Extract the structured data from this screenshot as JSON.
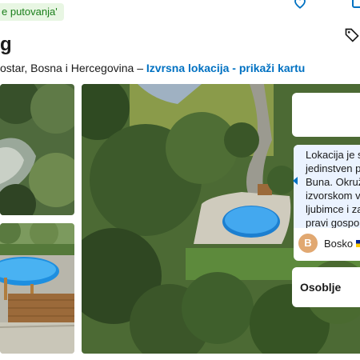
{
  "badge": {
    "text": "e putovanja'"
  },
  "header": {
    "title": "g",
    "address": "ostar, Bosna i Hercegovina –",
    "map_link": "Izvrsna lokacija - prikaži kartu"
  },
  "review": {
    "lines": [
      "Lokacija je s",
      "jedinstven p",
      "Buna. Okruž",
      "izvorskom v",
      "ljubimce i za",
      "pravi gospo"
    ],
    "reviewer_initial": "B",
    "reviewer_name": "Bosko"
  },
  "staff": {
    "label": "Osoblje"
  },
  "icons": {
    "heart": "heart-icon",
    "share": "share-icon",
    "price_tag": "price-tag-icon",
    "flag": "flag-icon"
  },
  "colors": {
    "link": "#0071c2",
    "badge_bg": "#e8f6e3",
    "badge_text": "#1a7f1a",
    "bubble_bg": "#ebf3ff",
    "avatar": "#e1a871"
  }
}
